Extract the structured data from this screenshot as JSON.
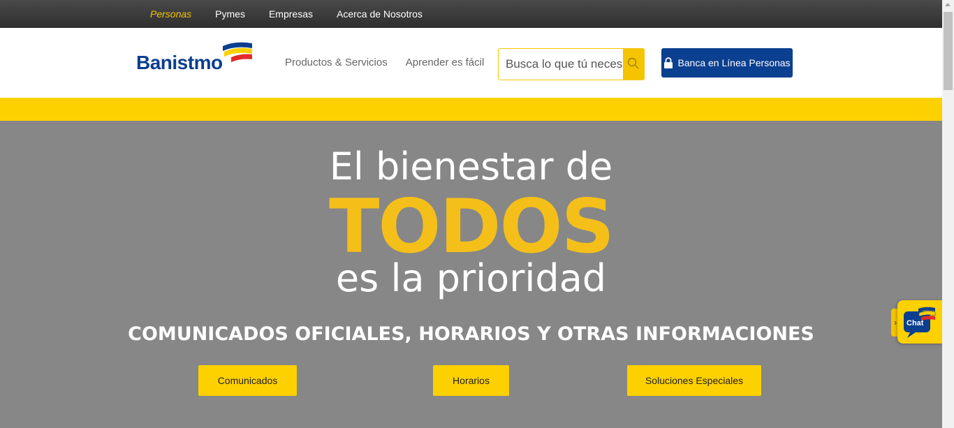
{
  "topnav": {
    "items": [
      {
        "label": "Personas",
        "active": true
      },
      {
        "label": "Pymes",
        "active": false
      },
      {
        "label": "Empresas",
        "active": false
      },
      {
        "label": "Acerca de Nosotros",
        "active": false
      }
    ]
  },
  "header": {
    "logo_text": "Banistmo",
    "nav": [
      "Productos & Servicios",
      "Aprender es fácil"
    ],
    "search_placeholder": "Busca lo que tú necesitas",
    "online_banking_label": "Banca en Línea Personas"
  },
  "hero": {
    "line1": "El bienestar de",
    "line2": "TODOS",
    "line3": "es la prioridad",
    "subtitle": "COMUNICADOS OFICIALES, HORARIOS Y OTRAS INFORMACIONES",
    "buttons": [
      "Comunicados",
      "Horarios",
      "Soluciones Especiales"
    ]
  },
  "chat": {
    "label": "Chat",
    "toggle_glyph": "›"
  },
  "colors": {
    "brand_blue": "#0b3f8f",
    "brand_yellow": "#fdd000",
    "hero_gray": "#878787",
    "todos_yellow": "#f5bf1a"
  },
  "icons": [
    "search-icon",
    "lock-icon",
    "chat-icon",
    "chevron-right-icon"
  ]
}
